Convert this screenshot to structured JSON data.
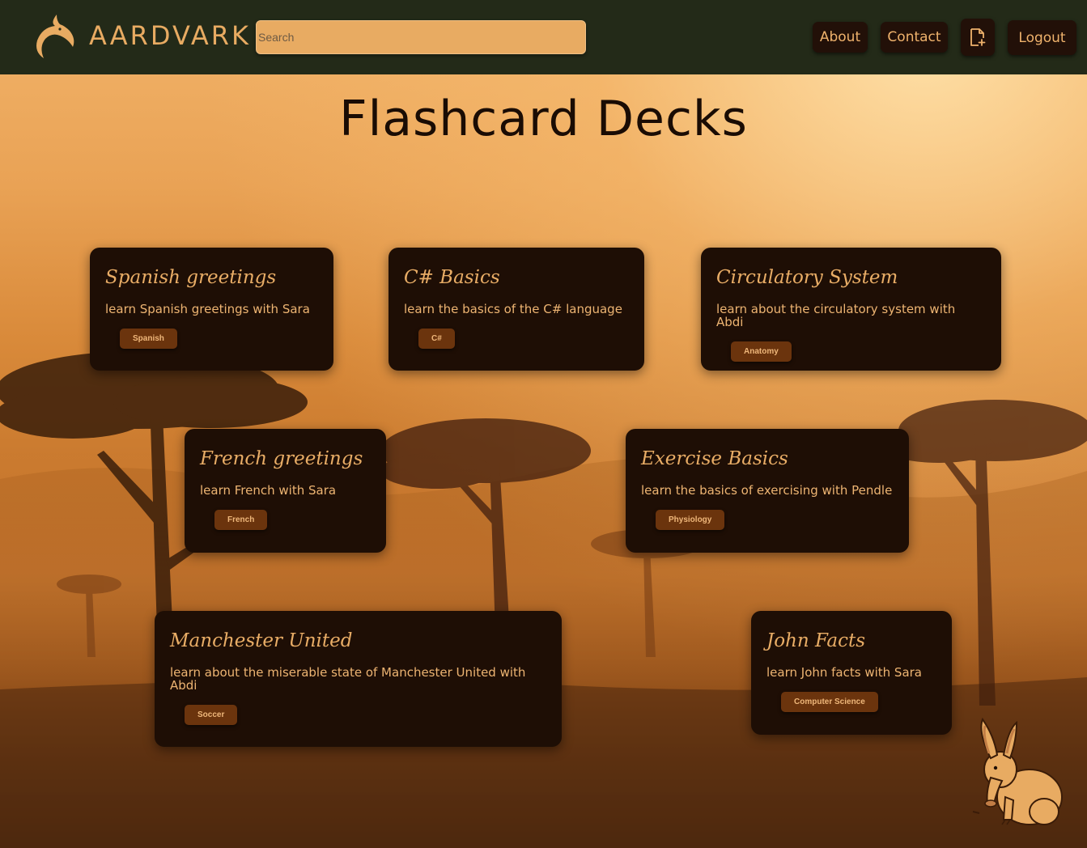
{
  "navbar": {
    "brand_name": "AARDVARK",
    "search_placeholder": "Search",
    "about_label": "About",
    "contact_label": "Contact",
    "logout_label": "Logout"
  },
  "page": {
    "title": "Flashcard Decks"
  },
  "decks": [
    {
      "title": "Spanish greetings",
      "description": "learn Spanish greetings with Sara",
      "tag": "Spanish"
    },
    {
      "title": "C# Basics",
      "description": "learn the basics of the C# language",
      "tag": "C#"
    },
    {
      "title": "Circulatory System",
      "description": "learn about the circulatory system with Abdi",
      "tag": "Anatomy"
    },
    {
      "title": "French greetings",
      "description": "learn French with Sara",
      "tag": "French"
    },
    {
      "title": "Exercise Basics",
      "description": "learn the basics of exercising with Pendle",
      "tag": "Physiology"
    },
    {
      "title": "Manchester United",
      "description": "learn about the miserable state of Manchester United with Abdi",
      "tag": "Soccer"
    },
    {
      "title": "John Facts",
      "description": "learn John facts with Sara",
      "tag": "Computer Science"
    }
  ],
  "icons": {
    "brand": "aardvark-logo-icon",
    "new_deck": "new-file-icon",
    "mascot": "aardvark-mascot"
  },
  "colors": {
    "navbar_bg": "#232a18",
    "accent": "#e8ab62",
    "card_bg": "#1e0e05",
    "tag_bg": "#6b340d"
  }
}
